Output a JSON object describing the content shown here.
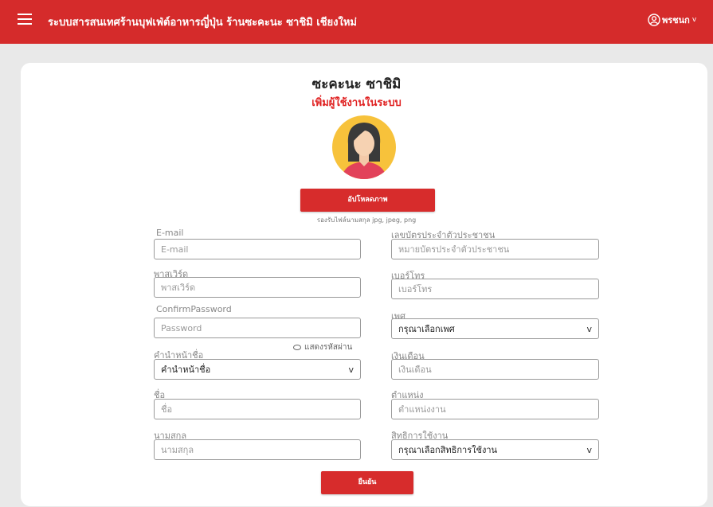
{
  "header": {
    "app_title": "ระบบสารสนเทศร้านบุฟเฟ่ต์อาหารญี่ปุ่น ร้านซะคะนะ ซาชิมิ เชียงใหม่",
    "user_name": "พรชนก",
    "user_chevron": "v"
  },
  "page": {
    "store_name": "ซะคะนะ ซาชิมิ",
    "subtitle": "เพิ่มผู้ใช้งานในระบบ"
  },
  "upload": {
    "button_label": "อัปโหลดภาพ",
    "note": "รองรับไฟล์นามสกุล jpg, jpeg, png"
  },
  "form": {
    "email": {
      "label": "E-mail",
      "placeholder": "E-mail"
    },
    "password": {
      "label": "พาสเวิร์ด",
      "placeholder": "พาสเวิร์ด"
    },
    "confirm_password": {
      "label": "ConfirmPassword",
      "placeholder": "Password"
    },
    "show_password": "แสดงรหัสผ่าน",
    "prefix": {
      "label": "คำนำหน้าชื่อ",
      "value": "คำนำหน้าชื่อ"
    },
    "first_name": {
      "label": "ชื่อ",
      "placeholder": "ชื่อ"
    },
    "last_name": {
      "label": "นามสกุล",
      "placeholder": "นามสกุล"
    },
    "national_id": {
      "label": "เลขบัตรประจำตัวประชาชน",
      "placeholder": "หมายบัตรประจำตัวประชาชน"
    },
    "phone": {
      "label": "เบอร์โทร",
      "placeholder": "เบอร์โทร"
    },
    "gender": {
      "label": "เพศ",
      "value": "กรุณาเลือกเพศ"
    },
    "salary": {
      "label": "เงินเดือน",
      "placeholder": "เงินเดือน"
    },
    "position": {
      "label": "ตำแหน่ง",
      "placeholder": "ตำแหน่งงาน"
    },
    "permission": {
      "label": "สิทธิการใช้งาน",
      "value": "กรุณาเลือกสิทธิการใช้งาน"
    },
    "select_chevron": "v",
    "submit_label": "ยืนยัน"
  },
  "colors": {
    "brand_red": "#d52b2b",
    "subtitle_red": "#e02323",
    "avatar_bg": "#f7c23b",
    "page_bg": "#e9e9e9"
  },
  "icons": {
    "menu": "hamburger-icon",
    "user": "user-circle-icon",
    "avatar": "female-avatar-icon"
  }
}
